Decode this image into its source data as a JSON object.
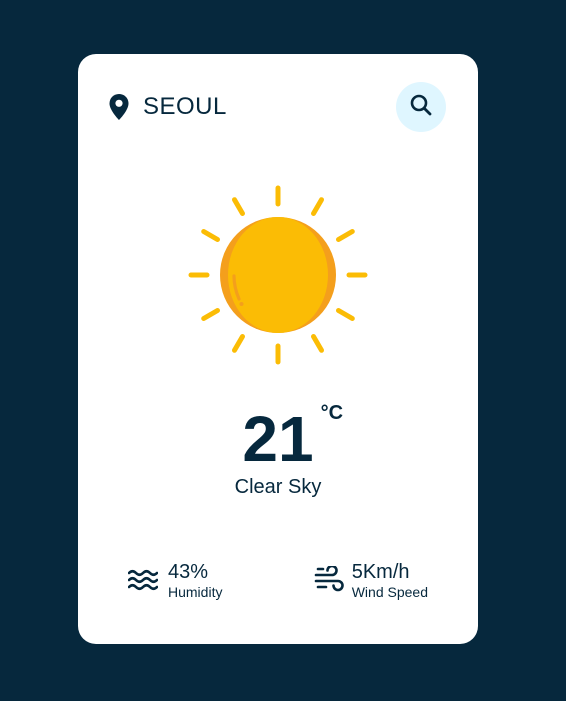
{
  "location": {
    "city": "SEOUL",
    "icon": "map-pin-icon"
  },
  "search": {
    "icon": "search-icon",
    "background_color": "#dff6ff"
  },
  "weather": {
    "icon": "sun-icon",
    "temperature": "21",
    "unit": "°C",
    "description": "Clear Sky"
  },
  "details": {
    "humidity": {
      "value": "43%",
      "label": "Humidity",
      "icon": "humidity-waves-icon"
    },
    "wind": {
      "value": "5Km/h",
      "label": "Wind Speed",
      "icon": "wind-icon"
    }
  },
  "colors": {
    "page_background": "#06283d",
    "card_background": "#ffffff",
    "text": "#06283d",
    "sun": "#fbbc05",
    "sun_shade": "#f49f1c"
  }
}
